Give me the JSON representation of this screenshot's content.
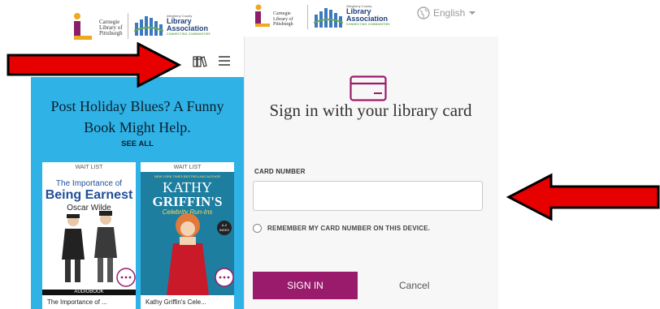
{
  "left_header": {
    "clp_name": [
      "Carnegie",
      "Library of",
      "Pittsburgh"
    ],
    "ala_small": "Allegheny County",
    "ala_name": [
      "Library",
      "Association"
    ],
    "ala_tagline": "CONNECTING COMMUNITIES"
  },
  "toolbar": {
    "bookshelf_icon": "bookshelf-icon",
    "menu_icon": "hamburger-menu-icon"
  },
  "promo": {
    "title_line1": "Post Holiday Blues? A Funny",
    "title_line2": "Book Might Help.",
    "see_all": "SEE ALL"
  },
  "books": [
    {
      "status": "WAIT LIST",
      "cover_title_1": "The Importance of",
      "cover_title_2": "Being Earnest",
      "cover_author": "Oscar Wilde",
      "format_badge": "AUDIOBOOK",
      "title": "The Importance of ..."
    },
    {
      "status": "WAIT LIST",
      "cover_top": "NEW YORK TIMES BESTSELLING AUTHOR",
      "cover_title_1": "KATHY",
      "cover_title_2": "GRIFFIN'S",
      "cover_subtitle": "Celebrity Run-Ins",
      "cover_badge": "A-Z INDEX",
      "title": "Kathy Griffin's Cele..."
    }
  ],
  "right_header": {
    "clp_name": [
      "Carnegie",
      "Library of",
      "Pittsburgh"
    ],
    "ala_small": "Allegheny County",
    "ala_name": [
      "Library",
      "Association"
    ],
    "ala_tagline": "CONNECTING COMMUNITIES",
    "language": "English"
  },
  "signin": {
    "title": "Sign in with your library card",
    "card_number_label": "CARD NUMBER",
    "card_number_value": "",
    "remember_label": "REMEMBER MY CARD NUMBER ON THIS DEVICE.",
    "signin_button": "SIGN IN",
    "cancel": "Cancel"
  },
  "colors": {
    "promo_bg": "#2fb2e6",
    "signin_button": "#9a1a6b",
    "arrow_fill": "#e60000"
  }
}
